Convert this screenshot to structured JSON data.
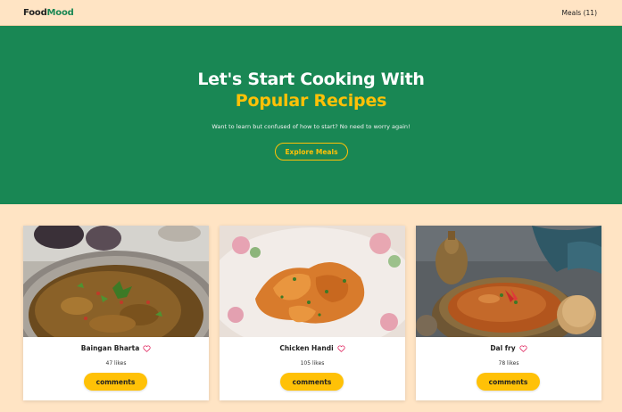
{
  "navbar": {
    "logo_part1": "Food",
    "logo_part2": "Mood",
    "meals_link": "Meals (11)"
  },
  "hero": {
    "title_line1": "Let's Start Cooking With",
    "title_line2": "Popular Recipes",
    "subtitle": "Want to learn but confused of how to start? No need to worry again!",
    "button_label": "Explore Meals"
  },
  "meals": [
    {
      "name": "Baingan Bharta",
      "likes": "47 likes",
      "comments_label": "comments"
    },
    {
      "name": "Chicken Handi",
      "likes": "105 likes",
      "comments_label": "comments"
    },
    {
      "name": "Dal fry",
      "likes": "78 likes",
      "comments_label": "comments"
    }
  ],
  "colors": {
    "background": "#ffe4c4",
    "hero_green": "#198754",
    "accent_yellow": "#ffc107",
    "heart_red": "#e0245e"
  }
}
